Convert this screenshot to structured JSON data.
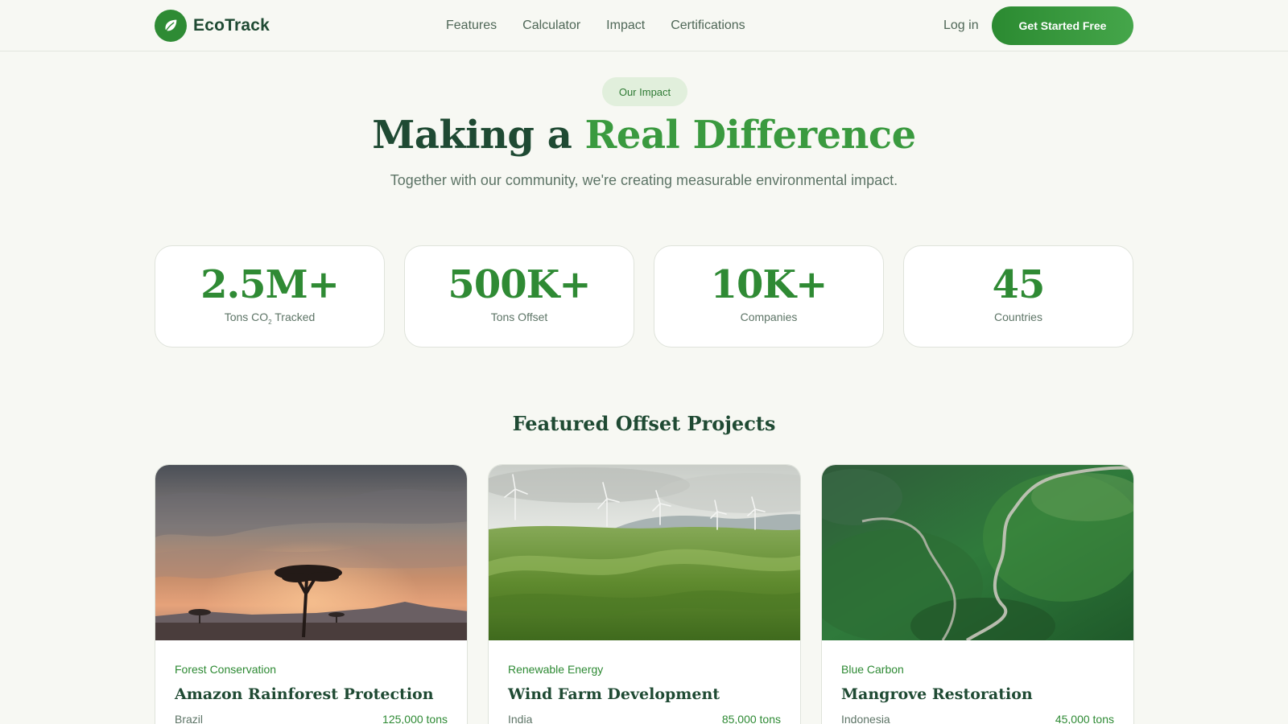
{
  "brand": {
    "name": "EcoTrack",
    "icon": "leaf-icon",
    "color": "#2e8b34"
  },
  "nav": {
    "items": [
      "Features",
      "Calculator",
      "Impact",
      "Certifications"
    ],
    "login_label": "Log in",
    "cta_label": "Get Started Free"
  },
  "hero": {
    "badge": "Our Impact",
    "title_prefix": "Making a ",
    "title_accent": "Real Difference",
    "subtitle": "Together with our community, we're creating measurable environmental impact."
  },
  "stats": [
    {
      "value": "2.5M+",
      "label_before": "Tons CO",
      "label_sub": "2",
      "label_after": " Tracked"
    },
    {
      "value": "500K+",
      "label": "Tons Offset"
    },
    {
      "value": "10K+",
      "label": "Companies"
    },
    {
      "value": "45",
      "label": "Countries"
    }
  ],
  "projects_section": {
    "title": "Featured Offset Projects",
    "projects": [
      {
        "category": "Forest Conservation",
        "title": "Amazon Rainforest Protection",
        "location": "Brazil",
        "tons": "125,000 tons",
        "image": "acacia-sunset-image"
      },
      {
        "category": "Renewable Energy",
        "title": "Wind Farm Development",
        "location": "India",
        "tons": "85,000 tons",
        "image": "wind-turbines-hills-image"
      },
      {
        "category": "Blue Carbon",
        "title": "Mangrove Restoration",
        "location": "Indonesia",
        "tons": "45,000 tons",
        "image": "green-valley-road-image"
      }
    ]
  },
  "colors": {
    "accent": "#3a9a3f",
    "dark": "#1f4a33",
    "background": "#f7f8f3"
  }
}
